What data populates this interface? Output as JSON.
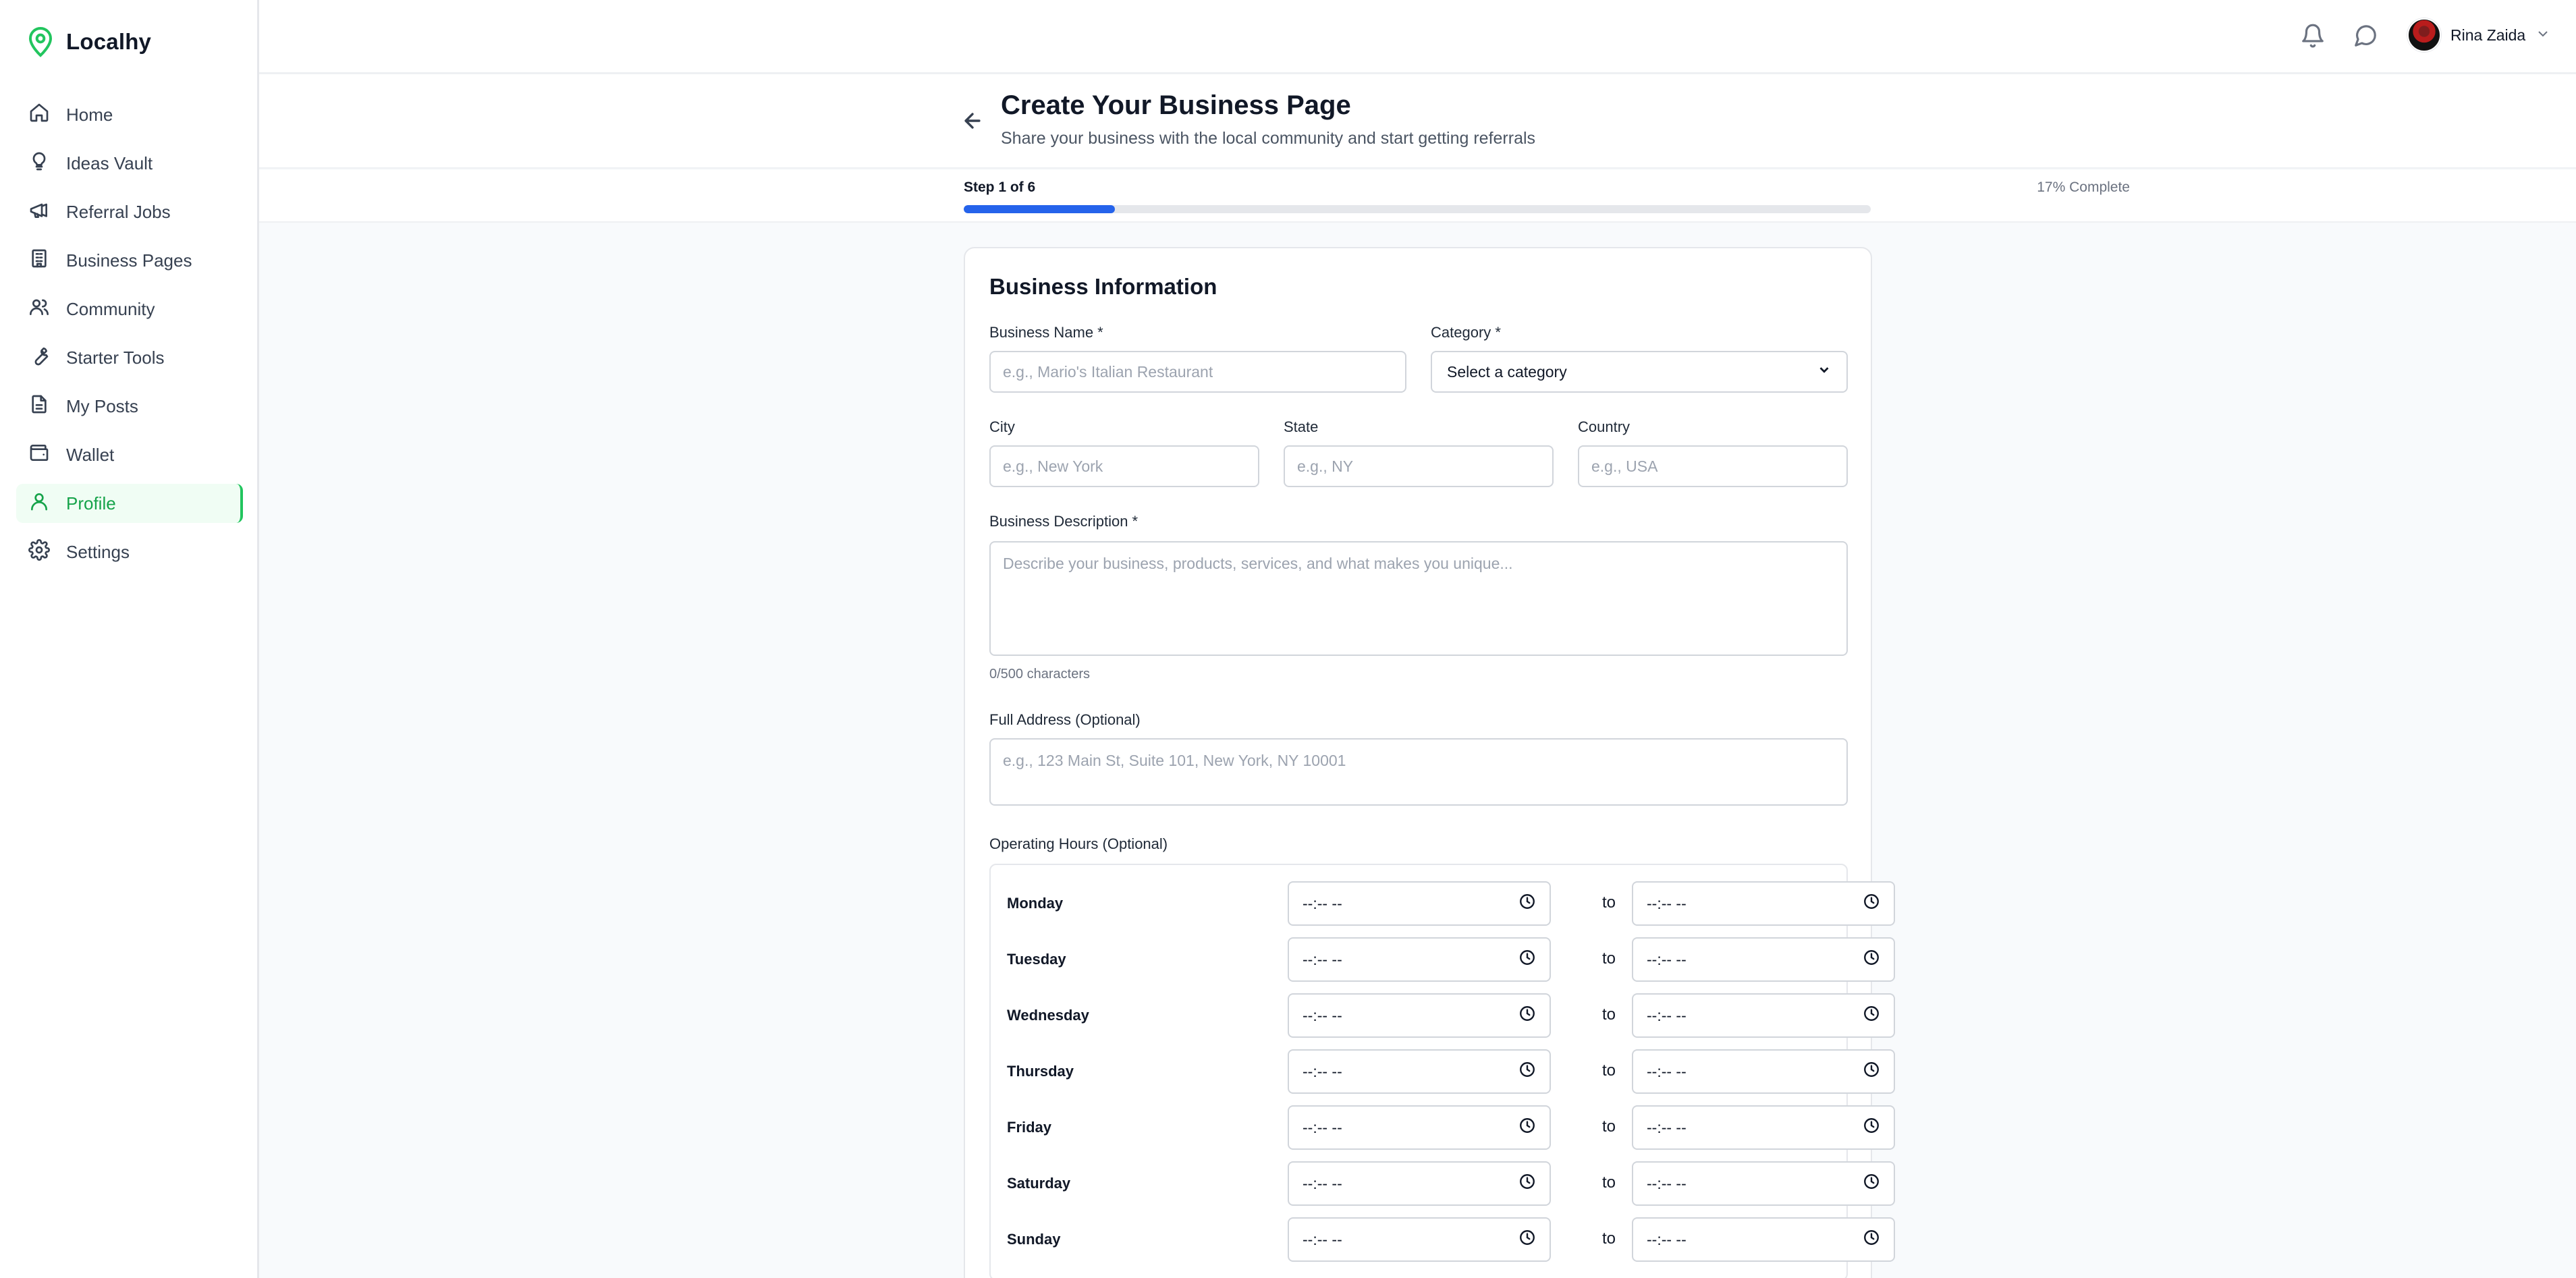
{
  "brand": {
    "name": "Localhy",
    "icon": "map-pin-icon",
    "accent": "#22c55e"
  },
  "sidebar": {
    "items": [
      {
        "label": "Home",
        "icon": "home-icon",
        "active": false
      },
      {
        "label": "Ideas Vault",
        "icon": "lightbulb-icon",
        "active": false
      },
      {
        "label": "Referral Jobs",
        "icon": "megaphone-icon",
        "active": false
      },
      {
        "label": "Business Pages",
        "icon": "building-icon",
        "active": false
      },
      {
        "label": "Community",
        "icon": "users-icon",
        "active": false
      },
      {
        "label": "Starter Tools",
        "icon": "wrench-icon",
        "active": false
      },
      {
        "label": "My Posts",
        "icon": "file-text-icon",
        "active": false
      },
      {
        "label": "Wallet",
        "icon": "wallet-icon",
        "active": false
      },
      {
        "label": "Profile",
        "icon": "user-icon",
        "active": true
      },
      {
        "label": "Settings",
        "icon": "gear-icon",
        "active": false
      }
    ]
  },
  "topbar": {
    "notification_icon": "bell-icon",
    "messages_icon": "message-circle-icon",
    "user": {
      "name": "Rina Zaida",
      "dropdown_icon": "chevron-down-icon"
    }
  },
  "header": {
    "title": "Create Your Business Page",
    "subtitle": "Share your business with the local community and start getting referrals"
  },
  "progress": {
    "step_label": "Step 1 of 6",
    "percent_label": "17% Complete",
    "fraction": 0.1667,
    "color": "#2563eb"
  },
  "form": {
    "section_title": "Business Information",
    "business_name": {
      "label": "Business Name *",
      "placeholder": "e.g., Mario's Italian Restaurant",
      "value": ""
    },
    "category": {
      "label": "Category *",
      "selected": "Select a category"
    },
    "city": {
      "label": "City",
      "placeholder": "e.g., New York",
      "value": ""
    },
    "state": {
      "label": "State",
      "placeholder": "e.g., NY",
      "value": ""
    },
    "country": {
      "label": "Country",
      "placeholder": "e.g., USA",
      "value": ""
    },
    "description": {
      "label": "Business Description *",
      "placeholder": "Describe your business, products, services, and what makes you unique...",
      "value": "",
      "char_count": "0/500 characters"
    },
    "address": {
      "label": "Full Address (Optional)",
      "placeholder": "e.g., 123 Main St, Suite 101, New York, NY 10001",
      "value": ""
    },
    "hours": {
      "label": "Operating Hours (Optional)",
      "to_label": "to",
      "time_placeholder": "--:-- --",
      "days": [
        "Monday",
        "Tuesday",
        "Wednesday",
        "Thursday",
        "Friday",
        "Saturday",
        "Sunday"
      ]
    }
  }
}
